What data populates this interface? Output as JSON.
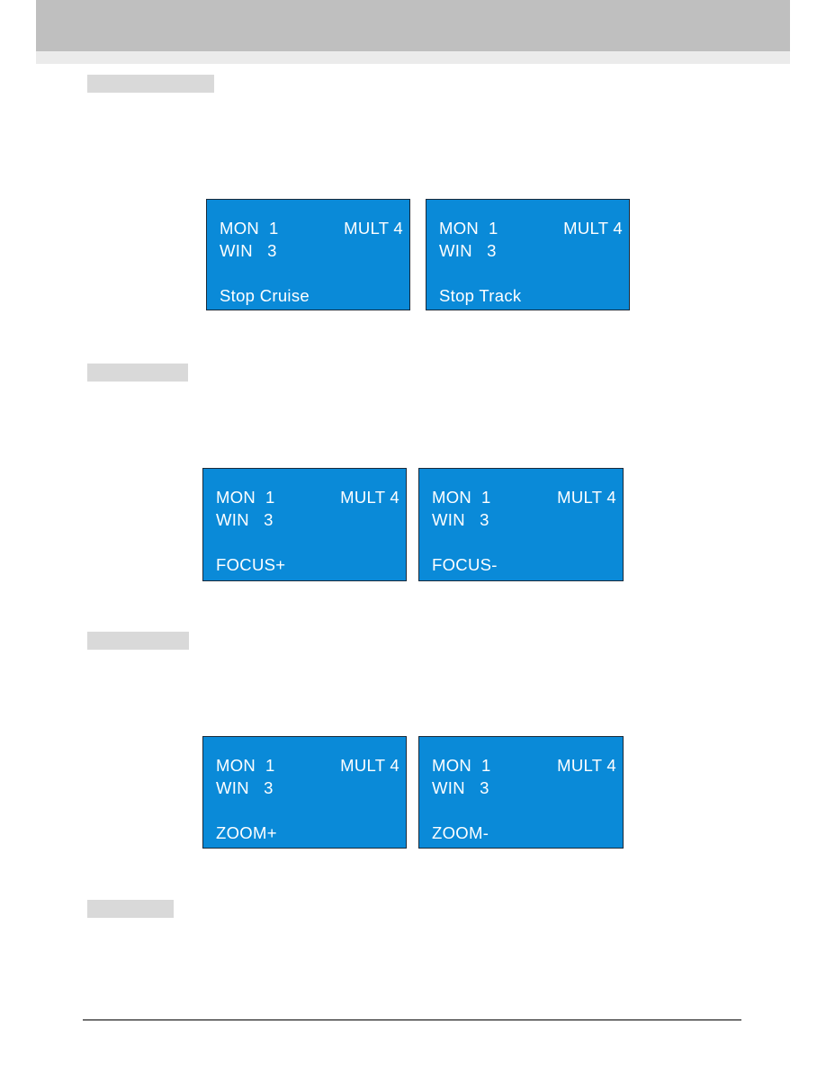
{
  "header": {
    "title": ""
  },
  "sections": [
    {
      "label": "",
      "displays": [
        {
          "mon": "MON  1",
          "win": "WIN   3",
          "mult": "MULT 4",
          "status": "Stop Cruise"
        },
        {
          "mon": "MON  1",
          "win": "WIN   3",
          "mult": "MULT 4",
          "status": "Stop Track"
        }
      ]
    },
    {
      "label": "",
      "displays": [
        {
          "mon": "MON  1",
          "win": "WIN   3",
          "mult": "MULT 4",
          "status": "FOCUS+"
        },
        {
          "mon": "MON  1",
          "win": "WIN   3",
          "mult": "MULT 4",
          "status": "FOCUS-"
        }
      ]
    },
    {
      "label": "",
      "displays": [
        {
          "mon": "MON  1",
          "win": "WIN   3",
          "mult": "MULT 4",
          "status": "ZOOM+"
        },
        {
          "mon": "MON  1",
          "win": "WIN   3",
          "mult": "MULT 4",
          "status": "ZOOM-"
        }
      ]
    },
    {
      "label": "",
      "displays": []
    }
  ],
  "colors": {
    "lcd_background": "#0a8ad8",
    "lcd_text": "#ffffff",
    "header": "#bfbfbf"
  }
}
